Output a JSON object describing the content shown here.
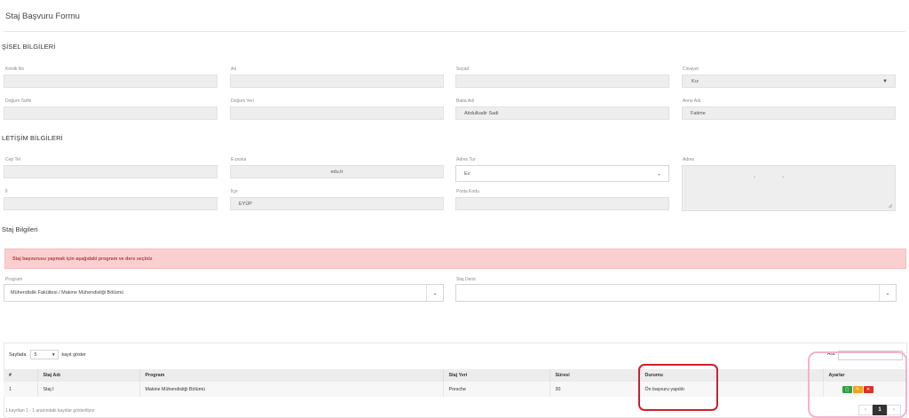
{
  "page": {
    "title": "Staj Başvuru Formu"
  },
  "personal": {
    "title": "ŞİSEL BİLGİLERİ",
    "labels": {
      "kimlik": "Kimlik No",
      "ad": "Ad",
      "soyad": "Soyad",
      "cinsiyet": "Cinsiyet",
      "dogum_tarihi": "Doğum Tarihi",
      "dogum_yeri": "Doğum Yeri",
      "baba_adi": "Baba Adı",
      "anne_adi": "Anne Adı"
    },
    "values": {
      "kimlik": "",
      "ad": "",
      "soyad": "",
      "cinsiyet": "Kız",
      "dogum_tarihi": "",
      "dogum_yeri": "",
      "baba_adi": "Abdulkadir Sadi",
      "anne_adi": "Fatime"
    }
  },
  "contact": {
    "title": "LETİŞİM BİLGİLERİ",
    "labels": {
      "cep_tel": "Cep Tel",
      "eposta": "E-posta",
      "adres_tur": "Adres Tur",
      "adres": "Adres",
      "il": "İl",
      "ilce": "İlçe",
      "posta_kodu": "Posta Kodu"
    },
    "values": {
      "cep_tel": "",
      "eposta": "edu.tr",
      "adres_tur": "Ev",
      "adres": "-                    -",
      "il": "",
      "ilce": "EYÜP",
      "posta_kodu": ""
    }
  },
  "staj": {
    "title": "Staj Bilgileri",
    "alert": "Staj başvurusu yapmak için aşağıdaki program ve ders seçiniz",
    "program_label": "Program",
    "program_value": "Mühendislik Fakültesi / Makine Mühendisliği Bölümü",
    "ders_label": "Staj Dersi",
    "ders_value": ""
  },
  "table": {
    "length_prefix": "Sayfada",
    "length_value": "5",
    "length_suffix": "kayıt göster",
    "search_label": "Ara:",
    "search_value": "",
    "headers": {
      "no": "#",
      "staj_adi": "Staj Adı",
      "program": "Program",
      "staj_yeri": "Staj Yeri",
      "suresi": "Süresi",
      "durumu": "Durumu",
      "ayarlar": "Ayarlar"
    },
    "rows": [
      {
        "no": "1",
        "staj_adi": "Staj I",
        "program": "Makine Mühendisliği Bölümü",
        "staj_yeri": "Porsche",
        "suresi": "30",
        "durumu": "Ön başvuru yapıldı"
      }
    ],
    "info": "1 kayıttan 1 - 1 arasındaki kayıtlar gösteriliyor",
    "pagination": {
      "prev": "‹",
      "current": "1",
      "next": "›"
    },
    "action_icons": [
      "view-icon",
      "edit-icon",
      "delete-icon"
    ],
    "action_glyphs": {
      "view": "▢",
      "edit": "✎",
      "delete": "✕"
    }
  },
  "colors": {
    "alert_bg": "#fbcfcf",
    "alert_text": "#a94442",
    "btn_green": "#2f9e44",
    "btn_orange": "#f0a31a",
    "btn_red": "#d9312b",
    "highlight_red": "#d01f2a",
    "highlight_pink": "#f0b4cc"
  }
}
